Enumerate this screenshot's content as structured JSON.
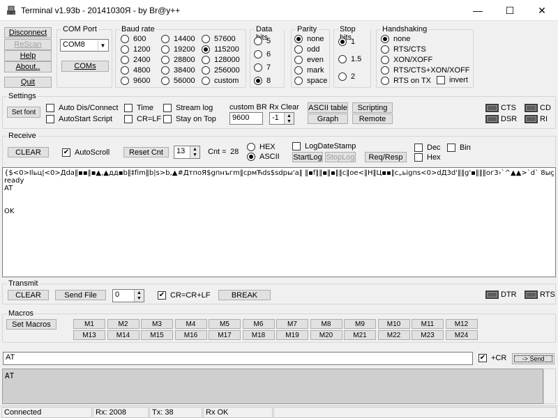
{
  "window": {
    "title": "Terminal v1.93b - 20141030Я - by Br@y++",
    "minimize_glyph": "—",
    "maximize_glyph": "☐",
    "close_glyph": "✕"
  },
  "left_buttons": {
    "disconnect": "Disconnect",
    "rescan": "ReScan",
    "help": "Help",
    "about": "About..",
    "quit": "Quit"
  },
  "com_port": {
    "label": "COM Port",
    "value": "COM8",
    "coms_button": "COMs"
  },
  "baud_rate": {
    "label": "Baud rate",
    "selected": "115200",
    "options": [
      "600",
      "1200",
      "2400",
      "4800",
      "9600",
      "14400",
      "19200",
      "28800",
      "38400",
      "56000",
      "57600",
      "115200",
      "128000",
      "256000",
      "custom"
    ]
  },
  "data_bits": {
    "label": "Data bits",
    "selected": "8",
    "options": [
      "5",
      "6",
      "7",
      "8"
    ]
  },
  "parity": {
    "label": "Parity",
    "selected": "none",
    "options": [
      "none",
      "odd",
      "even",
      "mark",
      "space"
    ]
  },
  "stop_bits": {
    "label": "Stop bits",
    "selected": "1",
    "options": [
      "1",
      "1.5",
      "2"
    ]
  },
  "handshaking": {
    "label": "Handshaking",
    "selected": "none",
    "options": [
      "none",
      "RTS/CTS",
      "XON/XOFF",
      "RTS/CTS+XON/XOFF",
      "RTS on TX"
    ],
    "invert_label": "invert"
  },
  "settings": {
    "label": "Settings",
    "set_font": "Set font",
    "auto_dis_connect": "Auto Dis/Connect",
    "autostart_script": "AutoStart Script",
    "time": "Time",
    "cr_lf": "CR=LF",
    "stream_log": "Stream log",
    "stay_on_top": "Stay on Top",
    "custom_br_label": "custom BR",
    "custom_br_value": "9600",
    "rx_clear_label": "Rx Clear",
    "rx_clear_value": "-1",
    "ascii_table": "ASCII table",
    "graph": "Graph",
    "scripting": "Scripting",
    "remote": "Remote",
    "leds": [
      "CTS",
      "CD",
      "DSR",
      "RI"
    ]
  },
  "receive": {
    "label": "Receive",
    "clear": "CLEAR",
    "autoscroll": "AutoScroll",
    "autoscroll_checked": true,
    "reset_cnt": "Reset Cnt",
    "cnt_spin": "13",
    "cnt_label": "Cnt =",
    "cnt_value": "28",
    "hex": "HEX",
    "ascii": "ASCII",
    "mode_selected": "ASCII",
    "log_date_stamp": "LogDateStamp",
    "start_log": "StartLog",
    "stop_log": "StopLog",
    "req_resp": "Req/Resp",
    "dec": "Dec",
    "hex2": "Hex",
    "bin": "Bin",
    "lines": [
      "{$<0>Ilьц|<0>Дdа‖▪▪‖▪▲,▲дд▪b‖‡fіm‖b|s>b,▲#ДтпоЯ$gпнъгm‖срмЋds$sdpы'a‖ ‖▪f‖‖▪‖▪‖‖с‖ое<‖Н‖Ц▪▪‖с„ьigпs<0>dД3d'‖‖g'▪‖‖‖ог3›`^▲▲>`d` 8ыgа‖▪‖г„ньbга▪‖▪▪с▪'",
      "ready",
      "AT",
      "",
      "",
      "OK"
    ]
  },
  "transmit": {
    "label": "Transmit",
    "clear": "CLEAR",
    "send_file": "Send File",
    "spin_value": "0",
    "cr_crlf": "CR=CR+LF",
    "cr_crlf_checked": true,
    "break": "BREAK",
    "leds": [
      "DTR",
      "RTS"
    ]
  },
  "macros": {
    "label": "Macros",
    "set_macros": "Set Macros",
    "items": [
      "M1",
      "M2",
      "M3",
      "M4",
      "M5",
      "M6",
      "M7",
      "M8",
      "M9",
      "M10",
      "M11",
      "M12",
      "M13",
      "M14",
      "M15",
      "M16",
      "M17",
      "M18",
      "M19",
      "M20",
      "M21",
      "M22",
      "M23",
      "M24"
    ]
  },
  "input": {
    "value": "AT",
    "plus_cr": "+CR",
    "plus_cr_checked": true,
    "send": "-> Send"
  },
  "transmit_area": {
    "text": "AT"
  },
  "status": {
    "connection": "Connected",
    "rx": "Rx: 2008",
    "tx": "Tx: 38",
    "rx_ok": "Rx OK"
  }
}
